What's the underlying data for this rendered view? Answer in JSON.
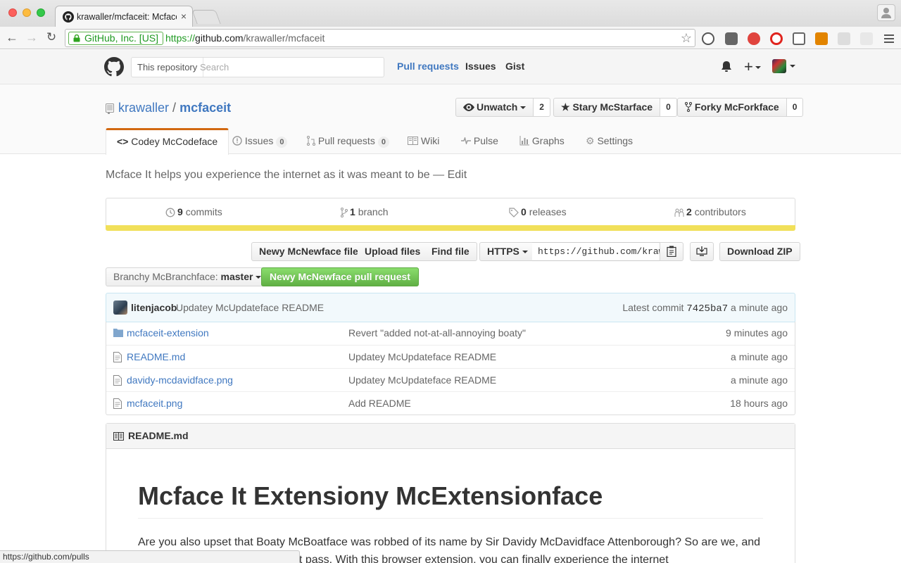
{
  "browser": {
    "tab_title": "krawaller/mcfaceit: Mcface",
    "tab_close": "×",
    "ev_label": "GitHub, Inc. [US]",
    "url_scheme": "https://",
    "url_host": "github.com",
    "url_path": "/krawaller/mcfaceit",
    "status_url": "https://github.com/pulls"
  },
  "header": {
    "scope_label": "This repository",
    "search_placeholder": "Search",
    "nav": [
      "Pull requests",
      "Issues",
      "Gist"
    ],
    "plus": "+"
  },
  "repo": {
    "owner": "krawaller",
    "separator": "/",
    "name": "mcfaceit",
    "watch_label": "Unwatch",
    "watch_count": "2",
    "star_label": "Stary McStarface",
    "star_count": "0",
    "fork_label": "Forky McForkface",
    "fork_count": "0"
  },
  "tabs": [
    {
      "label": "Codey McCodeface"
    },
    {
      "label": "Issues",
      "count": "0"
    },
    {
      "label": "Pull requests",
      "count": "0"
    },
    {
      "label": "Wiki"
    },
    {
      "label": "Pulse"
    },
    {
      "label": "Graphs"
    },
    {
      "label": "Settings"
    }
  ],
  "description": "Mcface It helps you experience the internet as it was meant to be",
  "description_sep": "—",
  "description_edit": "Edit",
  "summary": {
    "commits_count": "9",
    "commits_label": "commits",
    "branch_count": "1",
    "branch_label": "branch",
    "releases_count": "0",
    "releases_label": "releases",
    "contributors_count": "2",
    "contributors_label": "contributors",
    "language_color": "#f1e05a"
  },
  "file_nav": {
    "new_file": "Newy McNewface file",
    "upload": "Upload files",
    "find": "Find file",
    "protocol": "HTTPS",
    "clone_url": "https://github.com/krawaller/mcfaceit.git",
    "download": "Download ZIP",
    "branch_prefix": "Branchy McBranchface:",
    "branch_name": "master",
    "new_pr": "Newy McNewface pull request"
  },
  "latest_commit": {
    "author": "litenjacob",
    "message": "Updatey McUpdateface README",
    "prefix": "Latest commit",
    "sha": "7425ba7",
    "age": "a minute ago"
  },
  "files": [
    {
      "type": "dir",
      "name": "mcfaceit-extension",
      "message": "Revert \"added not-at-all-annoying boaty\"",
      "age": "9 minutes ago"
    },
    {
      "type": "file",
      "name": "README.md",
      "message": "Updatey McUpdateface README",
      "age": "a minute ago"
    },
    {
      "type": "file",
      "name": "davidy-mcdavidface.png",
      "message": "Updatey McUpdateface README",
      "age": "a minute ago"
    },
    {
      "type": "file",
      "name": "mcfaceit.png",
      "message": "Add README",
      "age": "18 hours ago"
    }
  ],
  "readme": {
    "filename": "README.md",
    "heading": "Mcface It Extensiony McExtensionface",
    "paragraph": "Are you also upset that Boaty McBoatface was robbed of its name by Sir Davidy McDavidface Attenborough? So are we, and we won't simply sit here and let it pass. With this browser extension, you can finally experience the internet"
  }
}
